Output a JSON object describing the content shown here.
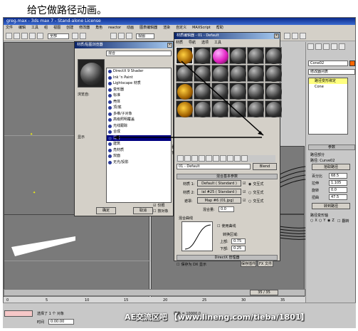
{
  "caption": "给它做路径动画。",
  "app": {
    "title": "greg.max - 3ds max 7 - Stand-alone License",
    "menus": [
      "文件",
      "编辑",
      "工具",
      "组",
      "视图",
      "创建",
      "修改器",
      "角色",
      "reactor",
      "动画",
      "图表编辑器",
      "渲染",
      "自定义",
      "MAXScript",
      "帮助"
    ],
    "selection_filter": "全部",
    "view_dropdown": "视图"
  },
  "browser": {
    "title": "材质/贴图浏览器",
    "search_label": "混合",
    "browse_from_label": "浏览自:",
    "browse_from": [
      {
        "label": "材质库",
        "on": false
      },
      {
        "label": "材质编辑器",
        "on": false
      },
      {
        "label": "活动示例窗",
        "on": false
      },
      {
        "label": "选定对象",
        "on": false
      },
      {
        "label": "场景",
        "on": false
      },
      {
        "label": "新建",
        "on": true
      }
    ],
    "show_label": "显示",
    "show": [
      {
        "label": "材质",
        "on": true
      },
      {
        "label": "贴图",
        "on": true
      },
      {
        "label": "不兼容",
        "on": false
      }
    ],
    "show2": [
      {
        "label": "仅根",
        "on": true
      },
      {
        "label": "按对象",
        "on": false
      }
    ],
    "items": [
      "DirectX 9 Shader",
      "Ink 'n Paint",
      "Lightscape 材质",
      "变形器",
      "标准",
      "壳体",
      "顶/底",
      "多维/子对象",
      "高级照明覆盖",
      "光线跟踪",
      "合成",
      "混合",
      "建筑",
      "亮材质",
      "双面",
      "无光/投影"
    ],
    "selected_index": 11,
    "ok": "确定",
    "cancel": "取消"
  },
  "mat_editor": {
    "title": "材质编辑器 - 01 - Default",
    "menus": [
      "材质",
      "导航",
      "选项",
      "工具"
    ],
    "type_button": "Blend",
    "material_name": "01 - Default",
    "rollout_basic": "混合基本参数",
    "mat1_label": "材质 1:",
    "mat1_value": "Default ( Standard )",
    "mat2_label": "材质 2:",
    "mat2_value": "ial #25 ( Standard )",
    "mask_label": "遮罩:",
    "mask_value": "Map #6 (01.jpg)",
    "interactive": "交互式",
    "mix_amount_label": "混合量:",
    "mix_amount": "0.0",
    "mix_curve_label": "混合曲线",
    "use_curve": "使用曲线",
    "transition_label": "转换区域:",
    "upper_label": "上部:",
    "upper_value": "0.75",
    "lower_label": "下部:",
    "lower_value": "0.25",
    "dx_rollout": "DirectX 管理器",
    "dx_check": "保存为 DX 显示",
    "dx_btn1": "保存插件",
    "dx_btn2": "FX 文件"
  },
  "cmd_panel": {
    "object_name": "Cone02",
    "modifier_list": "修改器列表",
    "stack_items": [
      "路径变形绑定",
      "Cone"
    ],
    "params_title": "参数",
    "path_label": "路径部分",
    "path_value": "路径: Curve02",
    "pick_path_btn": "拾取路径",
    "percent_label": "百分比",
    "percent_value": "68.5",
    "stretch_label": "拉伸",
    "stretch_value": "1.105",
    "rotation_label": "旋转",
    "rotation_value": "0.0",
    "twist_label": "扭曲",
    "twist_value": "47.5",
    "move_to_path": "转到路径",
    "axis_label": "路径变形轴",
    "axes": [
      "X",
      "Y",
      "Z"
    ],
    "flip": "翻转"
  },
  "timeline": {
    "frame_display": "35 / 35",
    "ticks": [
      "0",
      "5",
      "10",
      "15",
      "20",
      "25",
      "30",
      "35"
    ]
  },
  "status": {
    "selected": "选择了 1 个 对象",
    "grid_label": "栅格 = 10000.0",
    "time_label": "时间",
    "time_value": "0:00:00"
  },
  "watermark": "AE交流区吧 【www.lineng.com/tieba/1801】"
}
